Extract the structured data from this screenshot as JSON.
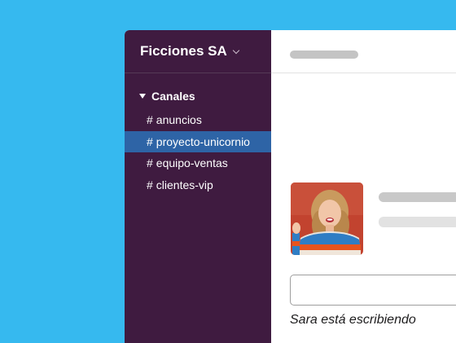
{
  "workspace": {
    "name": "Ficciones SA"
  },
  "sidebar": {
    "section_label": "Canales",
    "channels": [
      {
        "hash": "#",
        "name": "anuncios",
        "active": false
      },
      {
        "hash": "#",
        "name": "proyecto-unicornio",
        "active": true
      },
      {
        "hash": "#",
        "name": "equipo-ventas",
        "active": false
      },
      {
        "hash": "#",
        "name": "clientes-vip",
        "active": false
      }
    ]
  },
  "main": {
    "typing_indicator": "Sara está escribiendo"
  },
  "colors": {
    "background": "#36b9ef",
    "sidebar": "#3f1b40",
    "active_channel": "#2e64a6"
  },
  "icons": [
    "chevron-down-icon",
    "caret-down-icon"
  ]
}
